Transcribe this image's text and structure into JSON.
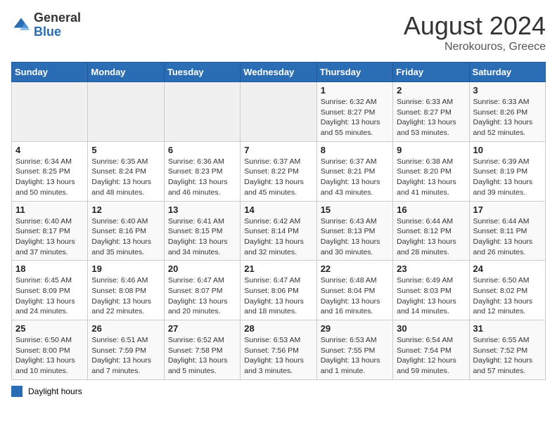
{
  "header": {
    "logo_general": "General",
    "logo_blue": "Blue",
    "month_year": "August 2024",
    "location": "Nerokouros, Greece"
  },
  "days_of_week": [
    "Sunday",
    "Monday",
    "Tuesday",
    "Wednesday",
    "Thursday",
    "Friday",
    "Saturday"
  ],
  "weeks": [
    [
      {
        "day": "",
        "info": ""
      },
      {
        "day": "",
        "info": ""
      },
      {
        "day": "",
        "info": ""
      },
      {
        "day": "",
        "info": ""
      },
      {
        "day": "1",
        "info": "Sunrise: 6:32 AM\nSunset: 8:27 PM\nDaylight: 13 hours\nand 55 minutes."
      },
      {
        "day": "2",
        "info": "Sunrise: 6:33 AM\nSunset: 8:27 PM\nDaylight: 13 hours\nand 53 minutes."
      },
      {
        "day": "3",
        "info": "Sunrise: 6:33 AM\nSunset: 8:26 PM\nDaylight: 13 hours\nand 52 minutes."
      }
    ],
    [
      {
        "day": "4",
        "info": "Sunrise: 6:34 AM\nSunset: 8:25 PM\nDaylight: 13 hours\nand 50 minutes."
      },
      {
        "day": "5",
        "info": "Sunrise: 6:35 AM\nSunset: 8:24 PM\nDaylight: 13 hours\nand 48 minutes."
      },
      {
        "day": "6",
        "info": "Sunrise: 6:36 AM\nSunset: 8:23 PM\nDaylight: 13 hours\nand 46 minutes."
      },
      {
        "day": "7",
        "info": "Sunrise: 6:37 AM\nSunset: 8:22 PM\nDaylight: 13 hours\nand 45 minutes."
      },
      {
        "day": "8",
        "info": "Sunrise: 6:37 AM\nSunset: 8:21 PM\nDaylight: 13 hours\nand 43 minutes."
      },
      {
        "day": "9",
        "info": "Sunrise: 6:38 AM\nSunset: 8:20 PM\nDaylight: 13 hours\nand 41 minutes."
      },
      {
        "day": "10",
        "info": "Sunrise: 6:39 AM\nSunset: 8:19 PM\nDaylight: 13 hours\nand 39 minutes."
      }
    ],
    [
      {
        "day": "11",
        "info": "Sunrise: 6:40 AM\nSunset: 8:17 PM\nDaylight: 13 hours\nand 37 minutes."
      },
      {
        "day": "12",
        "info": "Sunrise: 6:40 AM\nSunset: 8:16 PM\nDaylight: 13 hours\nand 35 minutes."
      },
      {
        "day": "13",
        "info": "Sunrise: 6:41 AM\nSunset: 8:15 PM\nDaylight: 13 hours\nand 34 minutes."
      },
      {
        "day": "14",
        "info": "Sunrise: 6:42 AM\nSunset: 8:14 PM\nDaylight: 13 hours\nand 32 minutes."
      },
      {
        "day": "15",
        "info": "Sunrise: 6:43 AM\nSunset: 8:13 PM\nDaylight: 13 hours\nand 30 minutes."
      },
      {
        "day": "16",
        "info": "Sunrise: 6:44 AM\nSunset: 8:12 PM\nDaylight: 13 hours\nand 28 minutes."
      },
      {
        "day": "17",
        "info": "Sunrise: 6:44 AM\nSunset: 8:11 PM\nDaylight: 13 hours\nand 26 minutes."
      }
    ],
    [
      {
        "day": "18",
        "info": "Sunrise: 6:45 AM\nSunset: 8:09 PM\nDaylight: 13 hours\nand 24 minutes."
      },
      {
        "day": "19",
        "info": "Sunrise: 6:46 AM\nSunset: 8:08 PM\nDaylight: 13 hours\nand 22 minutes."
      },
      {
        "day": "20",
        "info": "Sunrise: 6:47 AM\nSunset: 8:07 PM\nDaylight: 13 hours\nand 20 minutes."
      },
      {
        "day": "21",
        "info": "Sunrise: 6:47 AM\nSunset: 8:06 PM\nDaylight: 13 hours\nand 18 minutes."
      },
      {
        "day": "22",
        "info": "Sunrise: 6:48 AM\nSunset: 8:04 PM\nDaylight: 13 hours\nand 16 minutes."
      },
      {
        "day": "23",
        "info": "Sunrise: 6:49 AM\nSunset: 8:03 PM\nDaylight: 13 hours\nand 14 minutes."
      },
      {
        "day": "24",
        "info": "Sunrise: 6:50 AM\nSunset: 8:02 PM\nDaylight: 13 hours\nand 12 minutes."
      }
    ],
    [
      {
        "day": "25",
        "info": "Sunrise: 6:50 AM\nSunset: 8:00 PM\nDaylight: 13 hours\nand 10 minutes."
      },
      {
        "day": "26",
        "info": "Sunrise: 6:51 AM\nSunset: 7:59 PM\nDaylight: 13 hours\nand 7 minutes."
      },
      {
        "day": "27",
        "info": "Sunrise: 6:52 AM\nSunset: 7:58 PM\nDaylight: 13 hours\nand 5 minutes."
      },
      {
        "day": "28",
        "info": "Sunrise: 6:53 AM\nSunset: 7:56 PM\nDaylight: 13 hours\nand 3 minutes."
      },
      {
        "day": "29",
        "info": "Sunrise: 6:53 AM\nSunset: 7:55 PM\nDaylight: 13 hours\nand 1 minute."
      },
      {
        "day": "30",
        "info": "Sunrise: 6:54 AM\nSunset: 7:54 PM\nDaylight: 12 hours\nand 59 minutes."
      },
      {
        "day": "31",
        "info": "Sunrise: 6:55 AM\nSunset: 7:52 PM\nDaylight: 12 hours\nand 57 minutes."
      }
    ]
  ],
  "legend": {
    "label": "Daylight hours"
  }
}
